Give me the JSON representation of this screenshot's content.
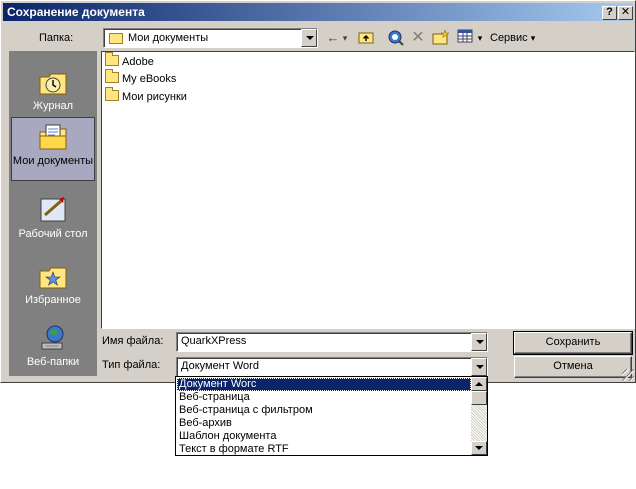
{
  "window": {
    "title": "Сохранение документа",
    "help_btn": "?",
    "close_btn": "✕"
  },
  "toolbar": {
    "folder_label": "Папка:",
    "folder_value": "Мои документы",
    "tools_label": "Сервис"
  },
  "places": [
    {
      "label": "Журнал",
      "icon": "history-icon"
    },
    {
      "label": "Мои документы",
      "icon": "my-documents-icon",
      "selected": true
    },
    {
      "label": "Рабочий стол",
      "icon": "desktop-icon"
    },
    {
      "label": "Избранное",
      "icon": "favorites-icon"
    },
    {
      "label": "Веб-папки",
      "icon": "web-folders-icon"
    }
  ],
  "files": [
    "Adobe",
    "My eBooks",
    "Мои рисунки"
  ],
  "form": {
    "filename_label": "Имя файла:",
    "filename_value": "QuarkXPress",
    "filetype_label": "Тип файла:",
    "filetype_value": "Документ Word"
  },
  "buttons": {
    "save": "Сохранить",
    "cancel": "Отмена"
  },
  "filetype_options": [
    "Документ Worc",
    "Веб-страница",
    "Веб-страница с фильтром",
    "Веб-архив",
    "Шаблон документа",
    "Текст в формате RTF"
  ],
  "colors": {
    "title_bar": "#0a246a",
    "dialog_face": "#d4d0c8",
    "places_bar": "#808080",
    "selection": "#0a246a"
  }
}
